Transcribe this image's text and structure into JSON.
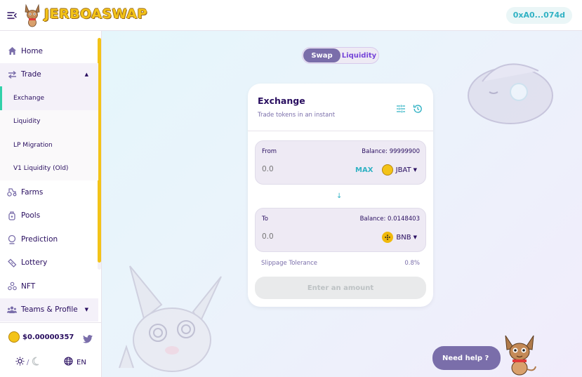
{
  "header": {
    "logo_text": "JERBOASWAP",
    "account": "0xA0...074d"
  },
  "sidebar": {
    "items": [
      {
        "label": "Home",
        "icon": "home-icon"
      },
      {
        "label": "Trade",
        "icon": "trade-icon"
      },
      {
        "label": "Farms",
        "icon": "farms-icon"
      },
      {
        "label": "Pools",
        "icon": "pools-icon"
      },
      {
        "label": "Prediction",
        "icon": "prediction-icon"
      },
      {
        "label": "Lottery",
        "icon": "lottery-icon"
      },
      {
        "label": "NFT",
        "icon": "nft-icon"
      },
      {
        "label": "Teams & Profile",
        "icon": "teams-icon"
      }
    ],
    "trade_subitems": [
      "Exchange",
      "Liquidity",
      "LP Migration",
      "V1 Liquidity (Old)"
    ],
    "active_subitem": "Exchange",
    "footer": {
      "price": "$0.00000357",
      "theme_separator": "/",
      "language": "EN"
    }
  },
  "tabs": [
    "Swap",
    "Liquidity"
  ],
  "active_tab": "Swap",
  "exchange": {
    "title": "Exchange",
    "subtitle": "Trade tokens in an instant",
    "from": {
      "label": "From",
      "balance": "Balance: 99999900",
      "placeholder": "0.0",
      "max_label": "MAX",
      "token": "JBAT"
    },
    "to": {
      "label": "To",
      "balance": "Balance: 0.0148403",
      "placeholder": "0.0",
      "token": "BNB"
    },
    "slippage_label": "Slippage Tolerance",
    "slippage_value": "0.8%",
    "submit_label": "Enter an amount"
  },
  "help": {
    "label": "Need help ?"
  },
  "colors": {
    "primary": "#7a6eaa",
    "accent": "#31b2c4",
    "active_indicator": "#31d0aa",
    "brand_yellow": "#f3c318",
    "text": "#280d5f"
  }
}
